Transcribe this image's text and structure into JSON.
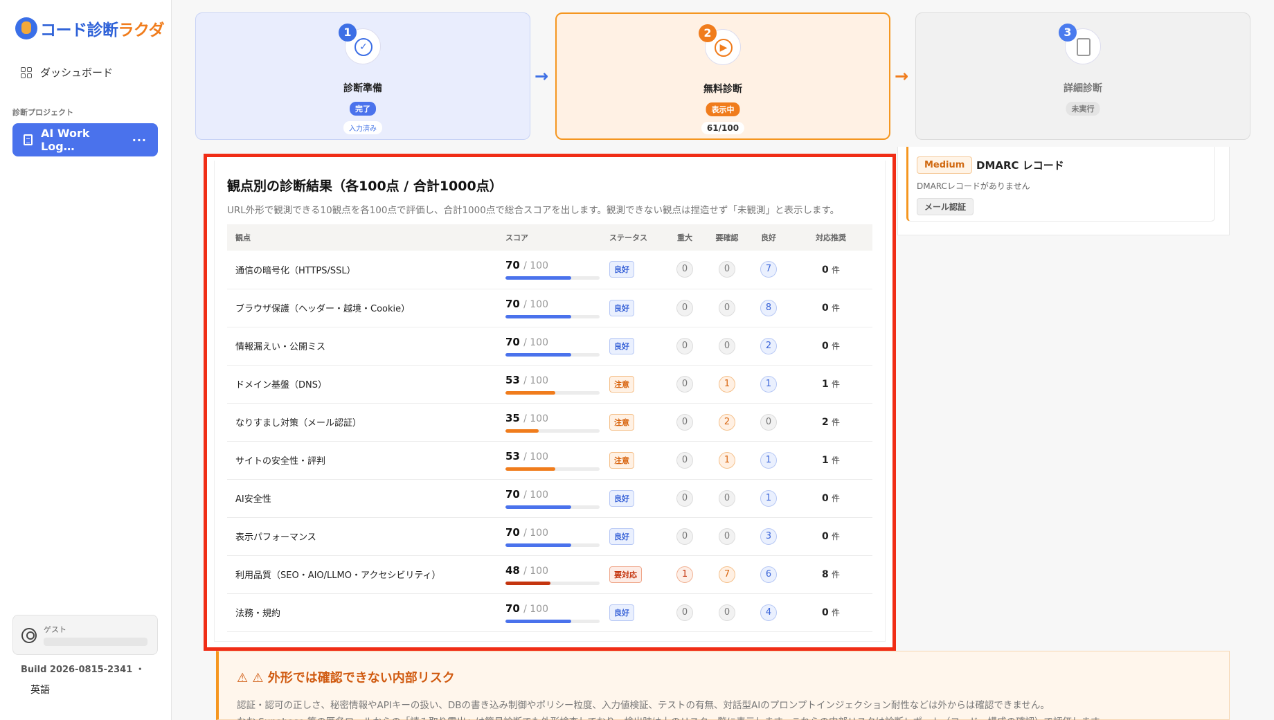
{
  "sidebar": {
    "logo_part1": "コード診断",
    "logo_part2": "ラクダ",
    "dashboard": "ダッシュボード",
    "section_label": "診断プロジェクト",
    "project_name": "AI Work Log…",
    "project_more": "···",
    "guest_label": "ゲスト",
    "build": "Build 2026-0815-2341 ・",
    "language": "英語"
  },
  "steps": [
    {
      "num": "1",
      "title": "診断準備",
      "badge": "完了",
      "sub": "入力済み"
    },
    {
      "num": "2",
      "title": "無料診断",
      "badge": "表示中",
      "sub": "61/100"
    },
    {
      "num": "3",
      "title": "詳細診断",
      "badge": "未実行",
      "sub": ""
    }
  ],
  "finding": {
    "severity": "Medium",
    "title": "DMARC レコード",
    "desc": "DMARCレコードがありません",
    "tag": "メール認証"
  },
  "results": {
    "title": "観点別の診断結果（各100点 / 合計1000点）",
    "desc": "URL外形で観測できる10観点を各100点で評価し、合計1000点で総合スコアを出します。観測できない観点は捏造せず「未観測」と表示します。",
    "headers": {
      "aspect": "観点",
      "score": "スコア",
      "status": "ステータス",
      "critical": "重大",
      "review": "要確認",
      "good": "良好",
      "action": "対応推奨"
    },
    "max_label": "/ 100",
    "unit": "件",
    "rows": [
      {
        "aspect": "通信の暗号化（HTTPS/SSL）",
        "score": 70,
        "status": "良好",
        "status_kind": "good",
        "critical": 0,
        "review": 0,
        "good": 7,
        "action": 0
      },
      {
        "aspect": "ブラウザ保護（ヘッダー・越境・Cookie）",
        "score": 70,
        "status": "良好",
        "status_kind": "good",
        "critical": 0,
        "review": 0,
        "good": 8,
        "action": 0
      },
      {
        "aspect": "情報漏えい・公開ミス",
        "score": 70,
        "status": "良好",
        "status_kind": "good",
        "critical": 0,
        "review": 0,
        "good": 2,
        "action": 0
      },
      {
        "aspect": "ドメイン基盤（DNS）",
        "score": 53,
        "status": "注意",
        "status_kind": "warn",
        "critical": 0,
        "review": 1,
        "good": 1,
        "action": 1
      },
      {
        "aspect": "なりすまし対策（メール認証）",
        "score": 35,
        "status": "注意",
        "status_kind": "warn",
        "critical": 0,
        "review": 2,
        "good": 0,
        "action": 2
      },
      {
        "aspect": "サイトの安全性・評判",
        "score": 53,
        "status": "注意",
        "status_kind": "warn",
        "critical": 0,
        "review": 1,
        "good": 1,
        "action": 1
      },
      {
        "aspect": "AI安全性",
        "score": 70,
        "status": "良好",
        "status_kind": "good",
        "critical": 0,
        "review": 0,
        "good": 1,
        "action": 0
      },
      {
        "aspect": "表示パフォーマンス",
        "score": 70,
        "status": "良好",
        "status_kind": "good",
        "critical": 0,
        "review": 0,
        "good": 3,
        "action": 0
      },
      {
        "aspect": "利用品質（SEO・AIO/LLMO・アクセシビリティ）",
        "score": 48,
        "status": "要対応",
        "status_kind": "crit",
        "critical": 1,
        "review": 7,
        "good": 6,
        "action": 8
      },
      {
        "aspect": "法務・規約",
        "score": 70,
        "status": "良好",
        "status_kind": "good",
        "critical": 0,
        "review": 0,
        "good": 4,
        "action": 0
      }
    ]
  },
  "risk": {
    "title": "⚠ ⚠ 外形では確認できない内部リスク",
    "line1": "認証・認可の正しさ、秘密情報やAPIキーの扱い、DBの書き込み制御やポリシー粒度、入力値検証、テストの有無、対話型AIのプロンプトインジェクション耐性などは外からは確認できません。",
    "line2": "なお Supabase 等の匿名ロールからの「読み取り露出」は簡易診断でも外形検査しており、検出時は上のリスク一覧に表示します。これらの内部リスクは診断レポート（コード・構成の確認）で評価します。"
  },
  "colors": {
    "bar_blue": "#4a72ec",
    "bar_orange": "#f07c1c",
    "bar_red": "#c4350f",
    "highlight": "#f02d16"
  }
}
